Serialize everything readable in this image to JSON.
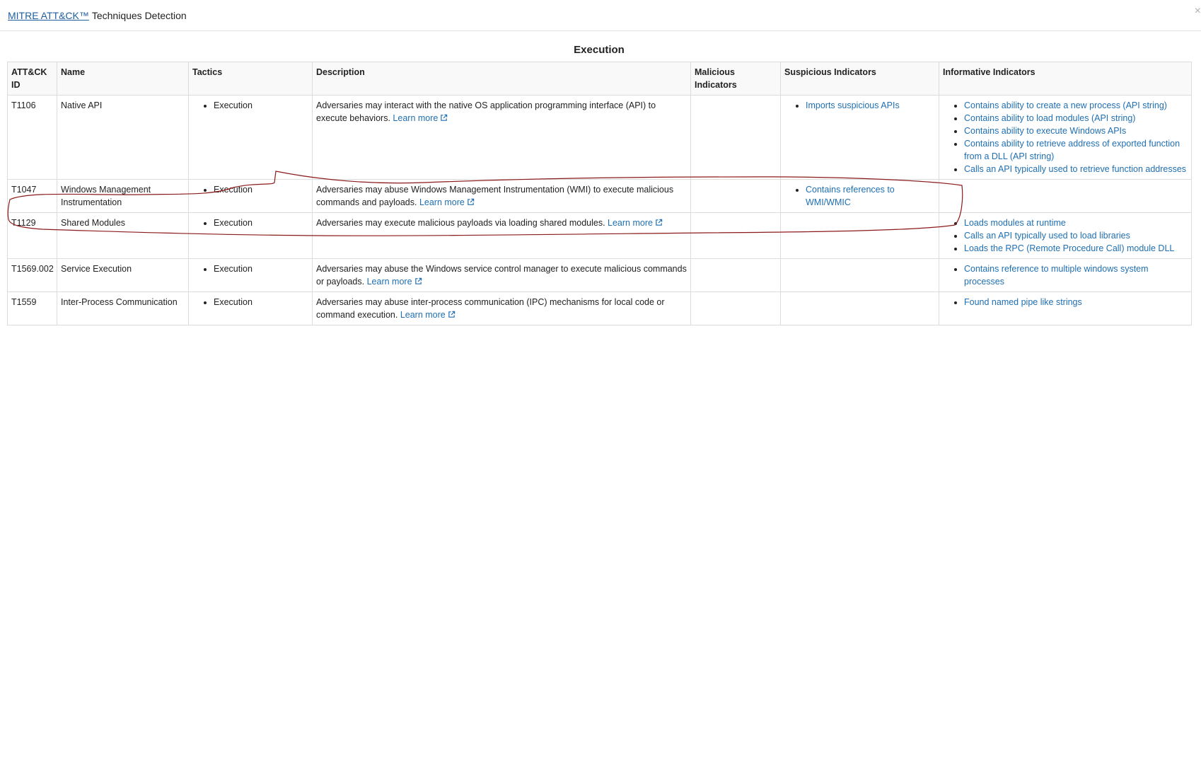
{
  "header": {
    "link_text": "MITRE ATT&CK™",
    "title_rest": "Techniques Detection",
    "close_glyph": "×"
  },
  "section": {
    "title": "Execution"
  },
  "table": {
    "columns": [
      "ATT&CK ID",
      "Name",
      "Tactics",
      "Description",
      "Malicious Indicators",
      "Suspicious Indicators",
      "Informative Indicators"
    ],
    "learn_more": "Learn more",
    "rows": [
      {
        "id": "T1106",
        "name": "Native API",
        "tactics": [
          "Execution"
        ],
        "description": "Adversaries may interact with the native OS application programming interface (API) to execute behaviors.",
        "malicious": [],
        "suspicious": [
          "Imports suspicious APIs"
        ],
        "informative": [
          "Contains ability to create a new process (API string)",
          "Contains ability to load modules (API string)",
          "Contains ability to execute Windows APIs",
          "Contains ability to retrieve address of exported function from a DLL (API string)",
          "Calls an API typically used to retrieve function addresses"
        ]
      },
      {
        "id": "T1047",
        "name": "Windows Management Instrumentation",
        "tactics": [
          "Execution"
        ],
        "description": "Adversaries may abuse Windows Management Instrumentation (WMI) to execute malicious commands and payloads.",
        "malicious": [],
        "suspicious": [
          "Contains references to WMI/WMIC"
        ],
        "informative": []
      },
      {
        "id": "T1129",
        "name": "Shared Modules",
        "tactics": [
          "Execution"
        ],
        "description": "Adversaries may execute malicious payloads via loading shared modules.",
        "malicious": [],
        "suspicious": [],
        "informative": [
          "Loads modules at runtime",
          "Calls an API typically used to load libraries",
          "Loads the RPC (Remote Procedure Call) module DLL"
        ]
      },
      {
        "id": "T1569.002",
        "name": "Service Execution",
        "tactics": [
          "Execution"
        ],
        "description": "Adversaries may abuse the Windows service control manager to execute malicious commands or payloads.",
        "malicious": [],
        "suspicious": [],
        "informative": [
          "Contains reference to multiple windows system processes"
        ]
      },
      {
        "id": "T1559",
        "name": "Inter-Process Communication",
        "tactics": [
          "Execution"
        ],
        "description": "Adversaries may abuse inter-process communication (IPC) mechanisms for local code or command execution.",
        "malicious": [],
        "suspicious": [],
        "informative": [
          "Found named pipe like strings"
        ]
      }
    ]
  },
  "colors": {
    "link": "#1f6fb2",
    "annotation": "#8b1a1a",
    "border": "#dcdcdc"
  }
}
